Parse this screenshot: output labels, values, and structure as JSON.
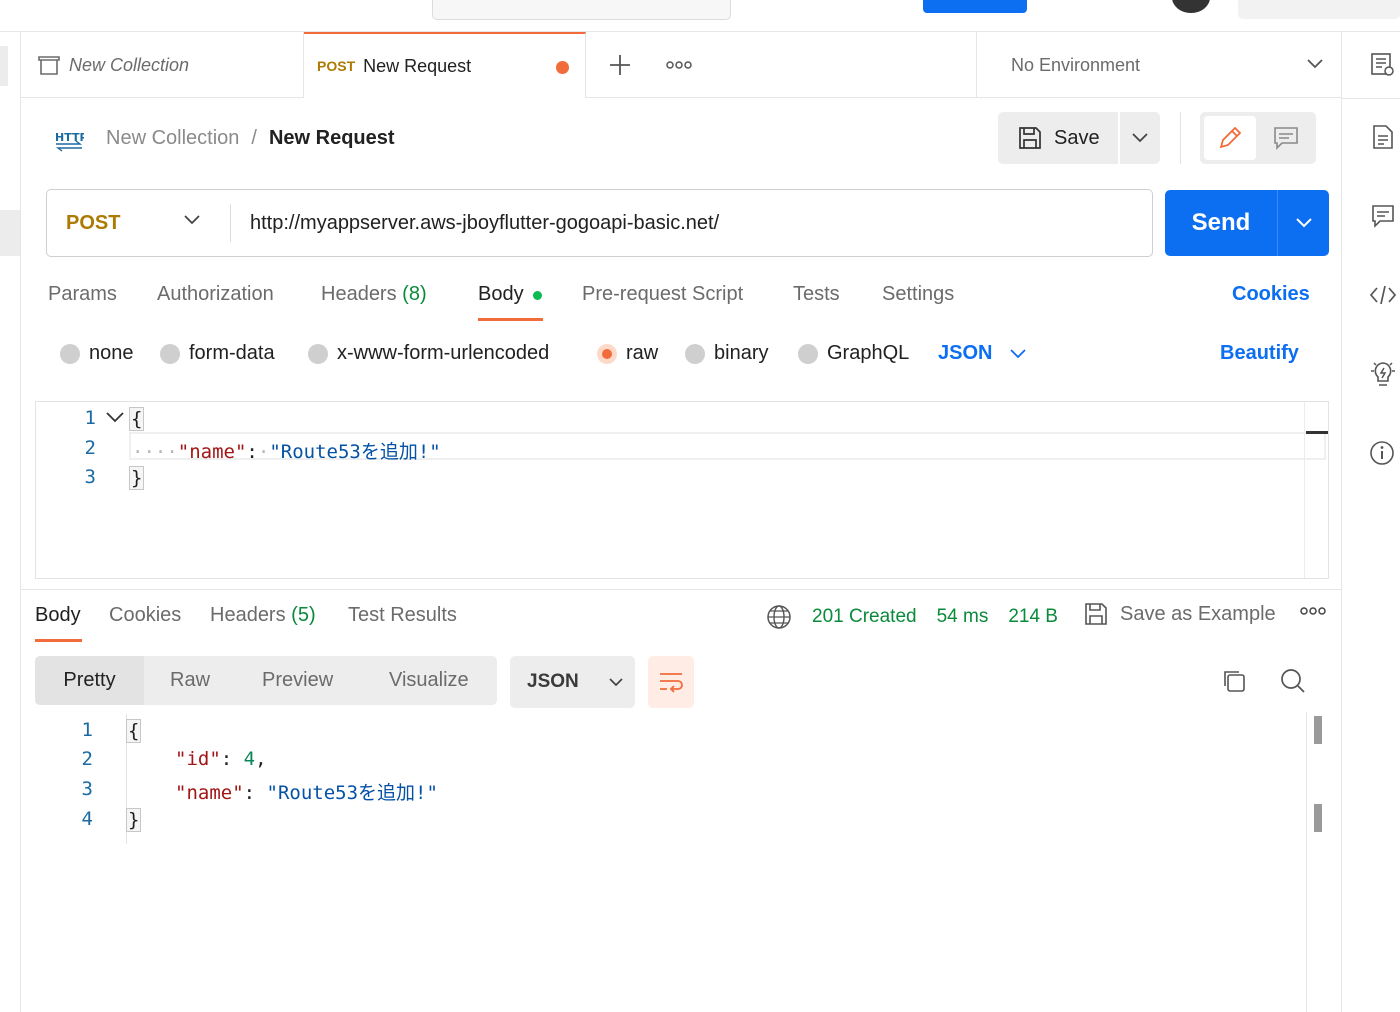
{
  "tabs": [
    {
      "label": "New Collection"
    },
    {
      "method": "POST",
      "label": "New Request"
    }
  ],
  "environment": {
    "selected": "No Environment"
  },
  "breadcrumb": {
    "collection": "New Collection",
    "separator": "/",
    "request": "New Request"
  },
  "toolbar": {
    "save_label": "Save"
  },
  "request": {
    "method": "POST",
    "url": "http://myappserver.aws-jboyflutter-gogoapi-basic.net/",
    "send_label": "Send",
    "tabs": [
      {
        "label": "Params",
        "count": ""
      },
      {
        "label": "Authorization",
        "count": ""
      },
      {
        "label": "Headers",
        "count": "(8)"
      },
      {
        "label": "Body",
        "count": ""
      },
      {
        "label": "Pre-request Script",
        "count": ""
      },
      {
        "label": "Tests",
        "count": ""
      },
      {
        "label": "Settings",
        "count": ""
      }
    ],
    "cookies_label": "Cookies",
    "body_types": [
      "none",
      "form-data",
      "x-www-form-urlencoded",
      "raw",
      "binary",
      "GraphQL"
    ],
    "body_type_selected": "raw",
    "body_format": "JSON",
    "beautify_label": "Beautify",
    "editor": {
      "line_numbers": [
        "1",
        "2",
        "3"
      ],
      "open_brace": "{",
      "close_brace": "}",
      "indent_dots": "····",
      "key": "\"name\"",
      "colon": ":",
      "value": "\"Route53を追加!\""
    }
  },
  "response": {
    "tabs": [
      {
        "label": "Body",
        "count": ""
      },
      {
        "label": "Cookies",
        "count": ""
      },
      {
        "label": "Headers",
        "count": "(5)"
      },
      {
        "label": "Test Results",
        "count": ""
      }
    ],
    "status": "201 Created",
    "time": "54 ms",
    "size": "214 B",
    "save_example_label": "Save as Example",
    "views": [
      "Pretty",
      "Raw",
      "Preview",
      "Visualize"
    ],
    "format": "JSON",
    "body": {
      "line_numbers": [
        "1",
        "2",
        "3",
        "4"
      ],
      "open_brace": "{",
      "close_brace": "}",
      "id_key": "\"id\"",
      "id_value": "4",
      "name_key": "\"name\"",
      "name_value": "\"Route53を追加!\"",
      "colon": ":",
      "comma": ","
    }
  },
  "colors": {
    "accent": "#0c6ef1",
    "active_tab": "#f26b3a",
    "post_method": "#ad7a03",
    "success": "#0a8a3a"
  },
  "icons": [
    "collection-icon",
    "plus-icon",
    "more-icon",
    "chevron-down-icon",
    "http-icon",
    "save-icon",
    "pencil-icon",
    "comment-icon",
    "globe-icon",
    "copy-icon",
    "search-icon",
    "wrap-icon",
    "documentation-icon",
    "code-icon",
    "lightbulb-icon",
    "info-icon"
  ]
}
